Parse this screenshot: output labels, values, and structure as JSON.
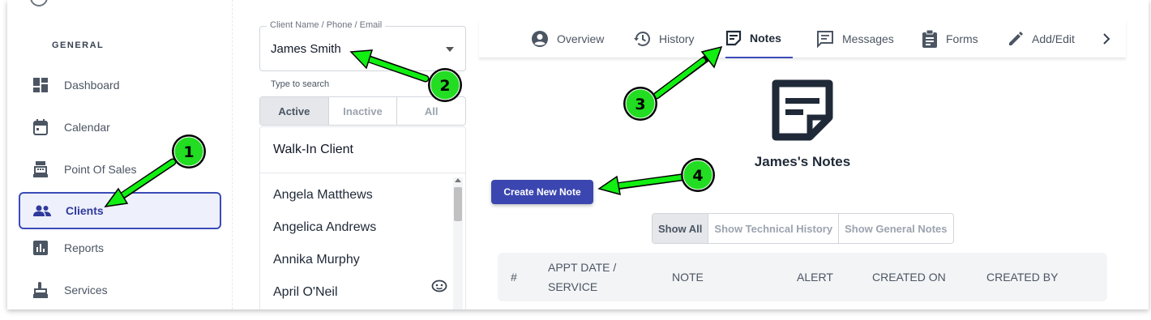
{
  "sidebar": {
    "section_title": "GENERAL",
    "items": [
      {
        "label": "Dashboard",
        "icon": "dashboard-icon"
      },
      {
        "label": "Calendar",
        "icon": "calendar-icon"
      },
      {
        "label": "Point Of Sales",
        "icon": "cash-register-icon"
      },
      {
        "label": "Clients",
        "icon": "people-icon",
        "active": true
      },
      {
        "label": "Reports",
        "icon": "bar-chart-icon"
      },
      {
        "label": "Services",
        "icon": "hand-icon"
      }
    ]
  },
  "client_picker": {
    "legend": "Client Name / Phone / Email",
    "value": "James Smith",
    "helper": "Type to search"
  },
  "status_filter": {
    "options": [
      "Active",
      "Inactive",
      "All"
    ],
    "selected": "Active"
  },
  "client_list": {
    "walk_in": "Walk-In Client",
    "clients": [
      "Angela Matthews",
      "Angelica Andrews",
      "Annika Murphy",
      "April O'Neil"
    ]
  },
  "tabs": {
    "items": [
      "Overview",
      "History",
      "Notes",
      "Messages",
      "Forms",
      "Add/Edit"
    ],
    "active": "Notes"
  },
  "notes": {
    "title": "James's Notes",
    "create_button": "Create New Note",
    "filters": [
      "Show All",
      "Show Technical History",
      "Show General Notes"
    ],
    "active_filter": "Show All",
    "columns": {
      "num": "#",
      "appt_line1": "APPT DATE /",
      "appt_line2": "SERVICE",
      "note": "NOTE",
      "alert": "ALERT",
      "created_on": "CREATED ON",
      "created_by": "CREATED BY"
    }
  },
  "annotations": [
    "1",
    "2",
    "3",
    "4"
  ],
  "colors": {
    "accent": "#3b46b0",
    "annotation_green": "#22dd22",
    "annotation_arrow": "#11ee11"
  }
}
